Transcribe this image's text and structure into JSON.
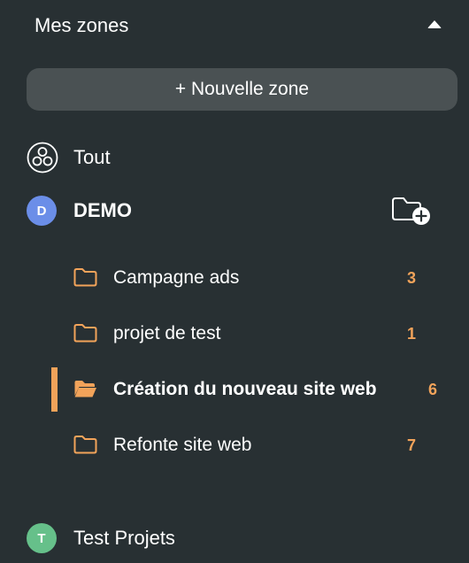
{
  "header": {
    "title": "Mes zones"
  },
  "new_zone_button": {
    "label": "+ Nouvelle zone"
  },
  "all_item": {
    "label": "Tout"
  },
  "workspaces": [
    {
      "initial": "D",
      "label": "DEMO",
      "avatar_color": "#6b8ee8",
      "folders": [
        {
          "label": "Campagne ads",
          "count": "3"
        },
        {
          "label": "projet de test",
          "count": "1"
        },
        {
          "label": "Création du nouveau site web",
          "count": "6",
          "active": true
        },
        {
          "label": "Refonte site web",
          "count": "7"
        }
      ]
    },
    {
      "initial": "T",
      "label": "Test Projets",
      "avatar_color": "#66c08a"
    }
  ],
  "colors": {
    "background": "#283033",
    "button_bg": "#4a5153",
    "accent": "#f2a35a"
  }
}
